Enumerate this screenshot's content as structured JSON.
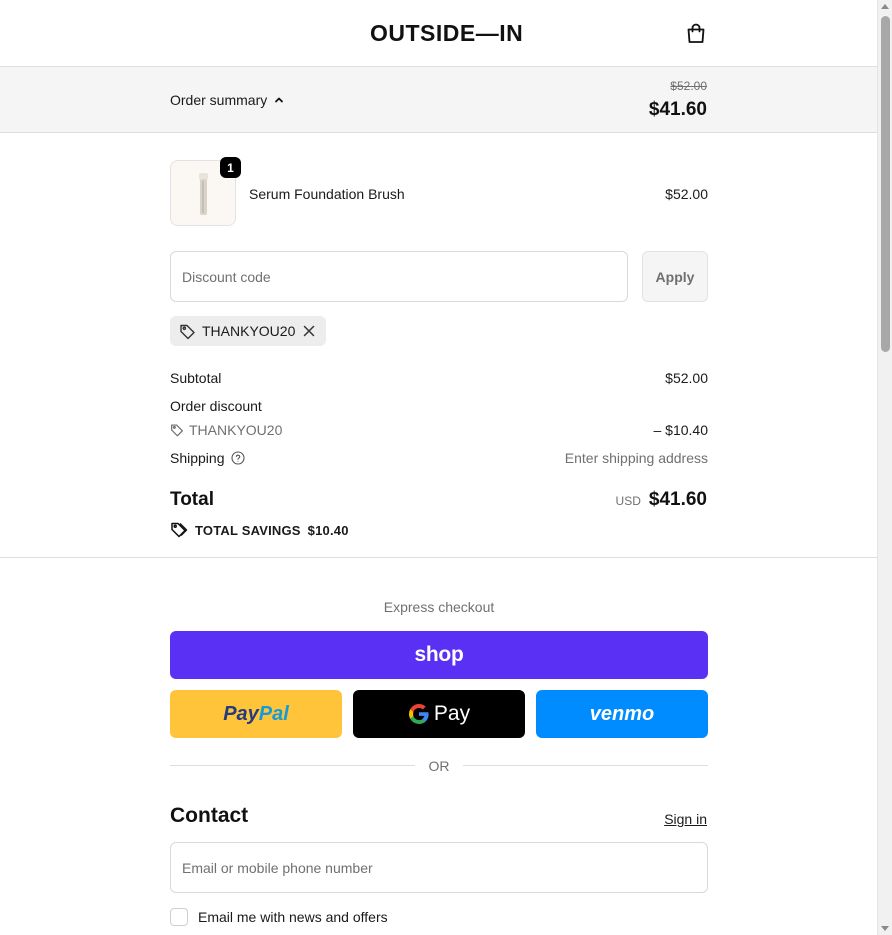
{
  "header": {
    "logo": "OUTSIDE—IN",
    "cart_icon": "shopping-bag-icon"
  },
  "summary": {
    "toggle_label": "Order summary",
    "original_price": "$52.00",
    "discounted_price": "$41.60"
  },
  "product": {
    "quantity": "1",
    "name": "Serum Foundation Brush",
    "price": "$52.00"
  },
  "discount": {
    "placeholder": "Discount code",
    "apply_label": "Apply",
    "applied_code": "THANKYOU20"
  },
  "totals": {
    "subtotal_label": "Subtotal",
    "subtotal_value": "$52.00",
    "order_discount_label": "Order discount",
    "discount_code": "THANKYOU20",
    "discount_value": "– $10.40",
    "shipping_label": "Shipping",
    "shipping_value": "Enter shipping address",
    "total_label": "Total",
    "currency": "USD",
    "total_value": "$41.60",
    "savings_label": "TOTAL SAVINGS",
    "savings_value": "$10.40"
  },
  "express": {
    "label": "Express checkout",
    "shop_label": "shop",
    "paypal_pay": "Pay",
    "paypal_pal": "Pal",
    "gpay_label": "Pay",
    "venmo_label": "venmo",
    "or_label": "OR"
  },
  "contact": {
    "title": "Contact",
    "sign_in": "Sign in",
    "email_placeholder": "Email or mobile phone number",
    "newsletter_label": "Email me with news and offers"
  },
  "colors": {
    "shop_pay": "#5a31f4",
    "paypal": "#ffc439",
    "gpay": "#000000",
    "venmo": "#008cff"
  }
}
